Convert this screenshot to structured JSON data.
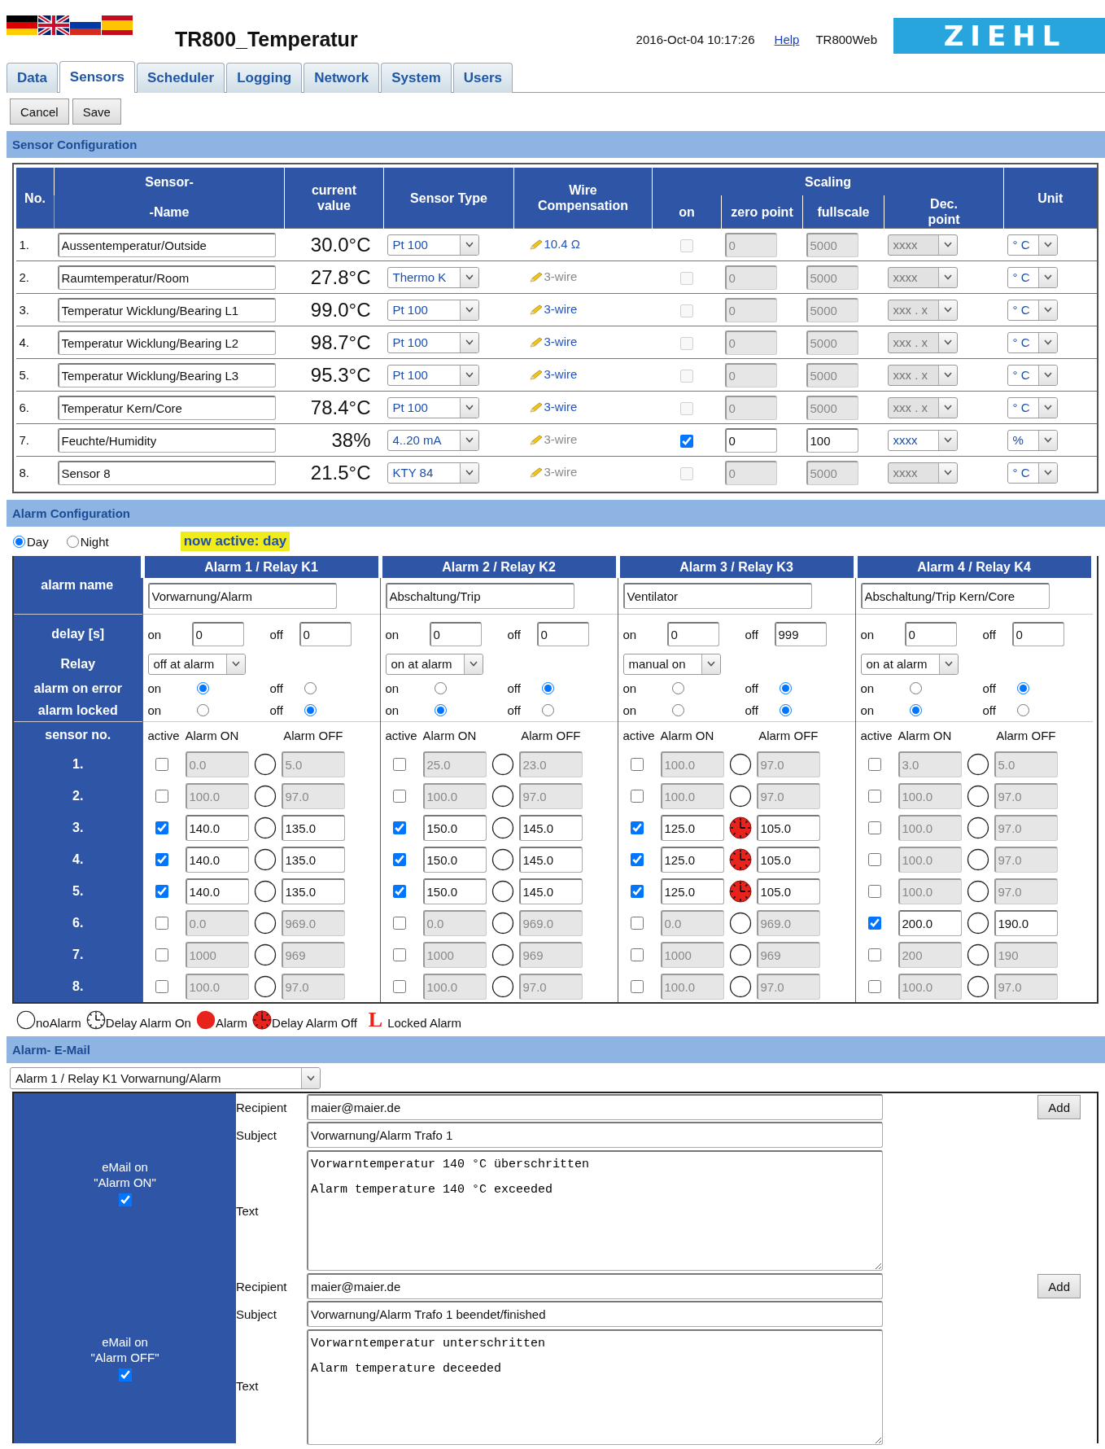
{
  "languages": [
    {
      "kind": "de"
    },
    {
      "kind": "en"
    },
    {
      "kind": "ru"
    },
    {
      "kind": "es"
    }
  ],
  "title": "TR800_Temperatur",
  "datetime": "2016-Oct-04 10:17:26",
  "help_link": "Help",
  "device": "TR800Web",
  "logo": "ZIEHL",
  "tabs": [
    {
      "label": "Data",
      "selected": false
    },
    {
      "label": "Sensors",
      "selected": true
    },
    {
      "label": "Scheduler",
      "selected": false
    },
    {
      "label": "Logging",
      "selected": false
    },
    {
      "label": "Network",
      "selected": false
    },
    {
      "label": "System",
      "selected": false
    },
    {
      "label": "Users",
      "selected": false
    }
  ],
  "buttons": [
    "Cancel",
    "Save"
  ],
  "sensor_section": {
    "title": "Sensor Configuration",
    "headers": {
      "no": "No.",
      "sensor": "Sensor-",
      "name": "-Name",
      "current_value": "current\nvalue",
      "sensor_type": "Sensor Type",
      "wire": "Wire\nCompensation",
      "scaling": "Scaling",
      "on": "on",
      "zero": "zero point",
      "fullscale": "fullscale",
      "decimal": "Dec.\npoint",
      "unit": "Unit"
    },
    "rows": [
      {
        "no": "1.",
        "name": "Aussentemperatur/Outside",
        "value": "30.0°C",
        "type": "Pt 100",
        "wire": "10.4 Ω",
        "wire_active": true,
        "scaling_on": false,
        "zero": "0",
        "fullscale": "5000",
        "decimal": "xxxx",
        "unit": "° C"
      },
      {
        "no": "2.",
        "name": "Raumtemperatur/Room",
        "value": "27.8°C",
        "type": "Thermo K",
        "wire": "3-wire",
        "wire_active": false,
        "scaling_on": false,
        "zero": "0",
        "fullscale": "5000",
        "decimal": "xxxx",
        "unit": "° C"
      },
      {
        "no": "3.",
        "name": "Temperatur Wicklung/Bearing L1",
        "value": "99.0°C",
        "type": "Pt 100",
        "wire": "3-wire",
        "wire_active": true,
        "scaling_on": false,
        "zero": "0",
        "fullscale": "5000",
        "decimal": "xxx . x",
        "unit": "° C"
      },
      {
        "no": "4.",
        "name": "Temperatur Wicklung/Bearing L2",
        "value": "98.7°C",
        "type": "Pt 100",
        "wire": "3-wire",
        "wire_active": true,
        "scaling_on": false,
        "zero": "0",
        "fullscale": "5000",
        "decimal": "xxx . x",
        "unit": "° C"
      },
      {
        "no": "5.",
        "name": "Temperatur Wicklung/Bearing L3",
        "value": "95.3°C",
        "type": "Pt 100",
        "wire": "3-wire",
        "wire_active": true,
        "scaling_on": false,
        "zero": "0",
        "fullscale": "5000",
        "decimal": "xxx . x",
        "unit": "° C"
      },
      {
        "no": "6.",
        "name": "Temperatur Kern/Core",
        "value": "78.4°C",
        "type": "Pt 100",
        "wire": "3-wire",
        "wire_active": true,
        "scaling_on": false,
        "zero": "0",
        "fullscale": "5000",
        "decimal": "xxx . x",
        "unit": "° C"
      },
      {
        "no": "7.",
        "name": "Feuchte/Humidity",
        "value": "38%",
        "type": "4..20 mA",
        "wire": "3-wire",
        "wire_active": false,
        "scaling_on": true,
        "zero": "0",
        "fullscale": "100",
        "decimal": "xxxx",
        "unit": "%"
      },
      {
        "no": "8.",
        "name": "Sensor 8",
        "value": "21.5°C",
        "type": "KTY 84",
        "wire": "3-wire",
        "wire_active": false,
        "scaling_on": false,
        "zero": "0",
        "fullscale": "5000",
        "decimal": "xxxx",
        "unit": "° C"
      }
    ]
  },
  "alarm_section": {
    "title": "Alarm Configuration",
    "modes": [
      {
        "label": "Day",
        "selected": true
      },
      {
        "label": "Night",
        "selected": false
      }
    ],
    "active_badge": "now active: day",
    "row_labels": {
      "name": "alarm name",
      "delay": "delay [s]",
      "relay": "Relay",
      "error": "alarm on error",
      "locked": "alarm locked",
      "sensor": "sensor no."
    },
    "sensor_numbers": [
      "1.",
      "2.",
      "3.",
      "4.",
      "5.",
      "6.",
      "7.",
      "8."
    ],
    "alarms": [
      {
        "title": "Alarm 1 / Relay K1",
        "name": "Vorwarnung/Alarm",
        "delay": {
          "on_label": "on",
          "on": "0",
          "off_label": "off",
          "off": "0"
        },
        "relay": "off at alarm",
        "on_error": {
          "on_label": "on",
          "off_label": "off",
          "on": true
        },
        "locked": {
          "on_label": "on",
          "off_label": "off",
          "on": false
        },
        "columns": {
          "active": "active",
          "alarm_on": "Alarm ON",
          "alarm_off": "Alarm OFF"
        },
        "sensors": [
          {
            "active": false,
            "alarm_on": "0.0",
            "kind": "no_alarm",
            "alarm_off": "5.0"
          },
          {
            "active": false,
            "alarm_on": "100.0",
            "kind": "no_alarm",
            "alarm_off": "97.0"
          },
          {
            "active": true,
            "alarm_on": "140.0",
            "kind": "no_alarm",
            "alarm_off": "135.0"
          },
          {
            "active": true,
            "alarm_on": "140.0",
            "kind": "no_alarm",
            "alarm_off": "135.0"
          },
          {
            "active": true,
            "alarm_on": "140.0",
            "kind": "no_alarm",
            "alarm_off": "135.0"
          },
          {
            "active": false,
            "alarm_on": "0.0",
            "kind": "no_alarm",
            "alarm_off": "969.0"
          },
          {
            "active": false,
            "alarm_on": "1000",
            "kind": "no_alarm",
            "alarm_off": "969"
          },
          {
            "active": false,
            "alarm_on": "100.0",
            "kind": "no_alarm",
            "alarm_off": "97.0"
          }
        ]
      },
      {
        "title": "Alarm 2 / Relay K2",
        "name": "Abschaltung/Trip",
        "delay": {
          "on_label": "on",
          "on": "0",
          "off_label": "off",
          "off": "0"
        },
        "relay": "on at alarm",
        "on_error": {
          "on_label": "on",
          "off_label": "off",
          "on": false
        },
        "locked": {
          "on_label": "on",
          "off_label": "off",
          "on": true
        },
        "columns": {
          "active": "active",
          "alarm_on": "Alarm ON",
          "alarm_off": "Alarm OFF"
        },
        "sensors": [
          {
            "active": false,
            "alarm_on": "25.0",
            "kind": "no_alarm",
            "alarm_off": "23.0"
          },
          {
            "active": false,
            "alarm_on": "100.0",
            "kind": "no_alarm",
            "alarm_off": "97.0"
          },
          {
            "active": true,
            "alarm_on": "150.0",
            "kind": "no_alarm",
            "alarm_off": "145.0"
          },
          {
            "active": true,
            "alarm_on": "150.0",
            "kind": "no_alarm",
            "alarm_off": "145.0"
          },
          {
            "active": true,
            "alarm_on": "150.0",
            "kind": "no_alarm",
            "alarm_off": "145.0"
          },
          {
            "active": false,
            "alarm_on": "0.0",
            "kind": "no_alarm",
            "alarm_off": "969.0"
          },
          {
            "active": false,
            "alarm_on": "1000",
            "kind": "no_alarm",
            "alarm_off": "969"
          },
          {
            "active": false,
            "alarm_on": "100.0",
            "kind": "no_alarm",
            "alarm_off": "97.0"
          }
        ]
      },
      {
        "title": "Alarm 3 / Relay K3",
        "name": "Ventilator",
        "delay": {
          "on_label": "on",
          "on": "0",
          "off_label": "off",
          "off": "999"
        },
        "relay": "manual on",
        "on_error": {
          "on_label": "on",
          "off_label": "off",
          "on": false
        },
        "locked": {
          "on_label": "on",
          "off_label": "off",
          "on": false
        },
        "columns": {
          "active": "active",
          "alarm_on": "Alarm ON",
          "alarm_off": "Alarm OFF"
        },
        "sensors": [
          {
            "active": false,
            "alarm_on": "100.0",
            "kind": "no_alarm",
            "alarm_off": "97.0"
          },
          {
            "active": false,
            "alarm_on": "100.0",
            "kind": "no_alarm",
            "alarm_off": "97.0"
          },
          {
            "active": true,
            "alarm_on": "125.0",
            "kind": "delay_off",
            "alarm_off": "105.0"
          },
          {
            "active": true,
            "alarm_on": "125.0",
            "kind": "delay_off",
            "alarm_off": "105.0"
          },
          {
            "active": true,
            "alarm_on": "125.0",
            "kind": "delay_off",
            "alarm_off": "105.0"
          },
          {
            "active": false,
            "alarm_on": "0.0",
            "kind": "no_alarm",
            "alarm_off": "969.0"
          },
          {
            "active": false,
            "alarm_on": "1000",
            "kind": "no_alarm",
            "alarm_off": "969"
          },
          {
            "active": false,
            "alarm_on": "100.0",
            "kind": "no_alarm",
            "alarm_off": "97.0"
          }
        ]
      },
      {
        "title": "Alarm 4 / Relay K4",
        "name": "Abschaltung/Trip Kern/Core",
        "delay": {
          "on_label": "on",
          "on": "0",
          "off_label": "off",
          "off": "0"
        },
        "relay": "on at alarm",
        "on_error": {
          "on_label": "on",
          "off_label": "off",
          "on": false
        },
        "locked": {
          "on_label": "on",
          "off_label": "off",
          "on": true
        },
        "columns": {
          "active": "active",
          "alarm_on": "Alarm ON",
          "alarm_off": "Alarm OFF"
        },
        "sensors": [
          {
            "active": false,
            "alarm_on": "3.0",
            "kind": "no_alarm",
            "alarm_off": "5.0"
          },
          {
            "active": false,
            "alarm_on": "100.0",
            "kind": "no_alarm",
            "alarm_off": "97.0"
          },
          {
            "active": false,
            "alarm_on": "100.0",
            "kind": "no_alarm",
            "alarm_off": "97.0"
          },
          {
            "active": false,
            "alarm_on": "100.0",
            "kind": "no_alarm",
            "alarm_off": "97.0"
          },
          {
            "active": false,
            "alarm_on": "100.0",
            "kind": "no_alarm",
            "alarm_off": "97.0"
          },
          {
            "active": true,
            "alarm_on": "200.0",
            "kind": "no_alarm",
            "alarm_off": "190.0"
          },
          {
            "active": false,
            "alarm_on": "200",
            "kind": "no_alarm",
            "alarm_off": "190"
          },
          {
            "active": false,
            "alarm_on": "100.0",
            "kind": "no_alarm",
            "alarm_off": "97.0"
          }
        ]
      }
    ],
    "legend": [
      {
        "kind": "no_alarm",
        "label": "noAlarm"
      },
      {
        "kind": "delay_on",
        "label": "Delay Alarm On"
      },
      {
        "kind": "alarm",
        "label": "Alarm"
      },
      {
        "kind": "delay_off",
        "label": "Delay Alarm Off"
      },
      {
        "kind": "locked",
        "symbol": "L",
        "label": "Locked Alarm"
      }
    ]
  },
  "email_section": {
    "title": "Alarm- E-Mail",
    "selector": "Alarm 1 / Relay K1 Vorwarnung/Alarm",
    "blocks": [
      {
        "heading": "eMail on\n\"Alarm ON\"",
        "enabled": true,
        "recipient_label": "Recipient",
        "recipient": "maier@maier.de",
        "subject_label": "Subject",
        "subject": "Vorwarnung/Alarm Trafo 1",
        "text_label": "Text",
        "text": "Vorwarntemperatur 140 °C überschritten\nAlarm temperature 140 °C exceeded",
        "add_button": "Add"
      },
      {
        "heading": "eMail on\n\"Alarm OFF\"",
        "enabled": true,
        "recipient_label": "Recipient",
        "recipient": "maier@maier.de",
        "subject_label": "Subject",
        "subject": "Vorwarnung/Alarm Trafo 1 beendet/finished",
        "text_label": "Text",
        "text": "Vorwarntemperatur unterschritten\nAlarm temperature deceeded",
        "add_button": "Add"
      }
    ]
  }
}
